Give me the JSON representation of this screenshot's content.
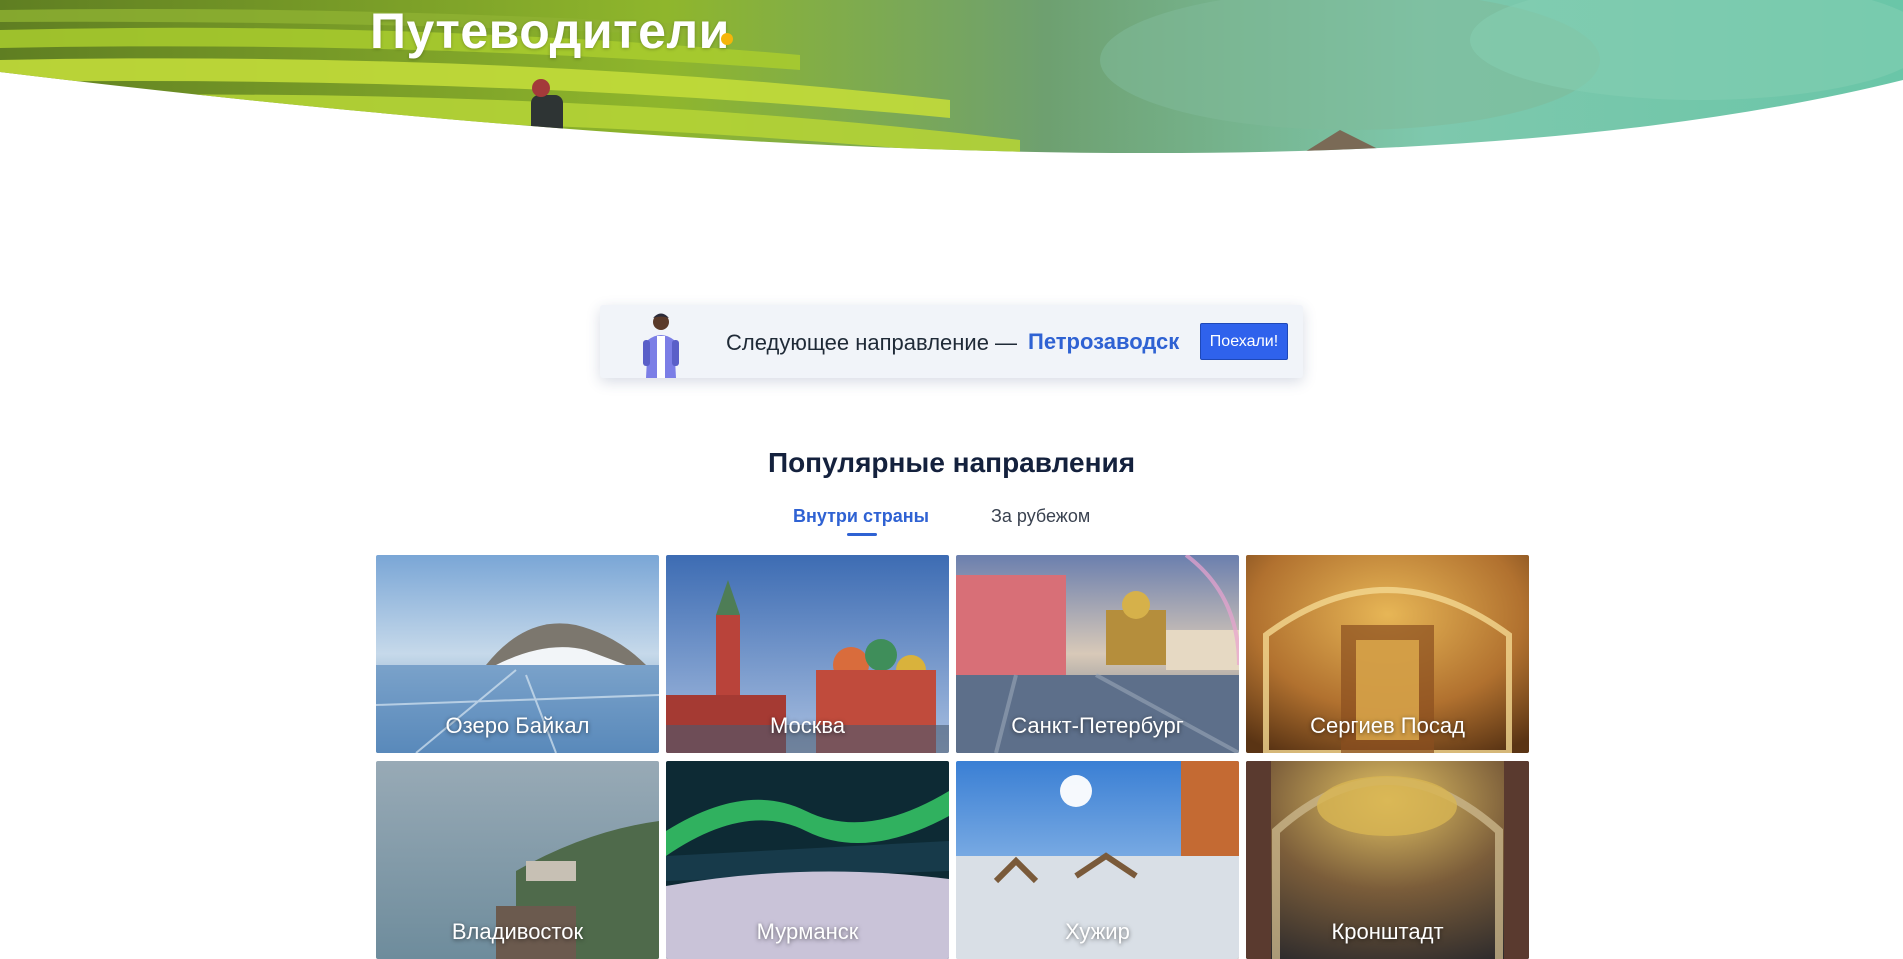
{
  "hero": {
    "title": "Путеводители"
  },
  "next_destination": {
    "text": "Следующее направление —",
    "city": "Петрозаводск",
    "button_label": "Поехали!"
  },
  "popular": {
    "title": "Популярные направления",
    "tabs": [
      {
        "label": "Внутри страны",
        "active": true
      },
      {
        "label": "За рубежом",
        "active": false
      }
    ],
    "cards": [
      {
        "label": "Озеро Байкал"
      },
      {
        "label": "Москва"
      },
      {
        "label": "Санкт-Петербург"
      },
      {
        "label": "Сергиев Посад"
      },
      {
        "label": "Владивосток"
      },
      {
        "label": "Мурманск"
      },
      {
        "label": "Хужир"
      },
      {
        "label": "Кронштадт"
      }
    ]
  },
  "colors": {
    "accent": "#2f62d3",
    "button": "#2f62ec",
    "title_dot": "#f5b50a",
    "heading": "#14213d"
  }
}
